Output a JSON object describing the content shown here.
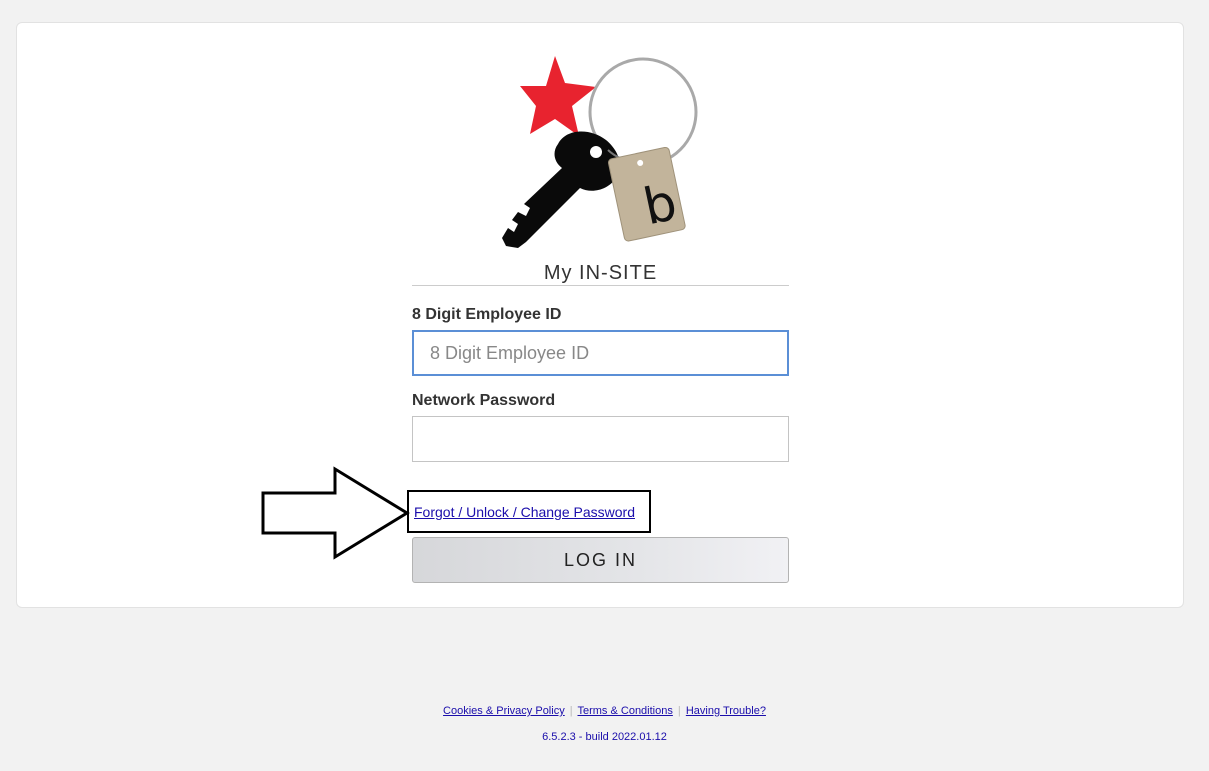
{
  "header": {
    "title": "My IN-SITE",
    "logo_letter": "b"
  },
  "form": {
    "employee_id_label": "8 Digit Employee ID",
    "employee_id_placeholder": "8 Digit Employee ID",
    "employee_id_value": "",
    "password_label": "Network Password",
    "password_value": "",
    "forgot_link": "Forgot / Unlock / Change Password",
    "login_label": "LOG IN"
  },
  "footer": {
    "links": [
      "Cookies & Privacy Policy",
      "Terms & Conditions",
      "Having Trouble?"
    ],
    "separator": "|",
    "version": "6.5.2.3 - build 2022.01.12"
  },
  "colors": {
    "star": "#e8232f",
    "tag": "#c2b49b",
    "link": "#1a0dab",
    "focus_border": "#5b8fd6"
  },
  "icons": {
    "logo": "key-star-tag-logo",
    "annotation": "arrow-right-icon"
  }
}
